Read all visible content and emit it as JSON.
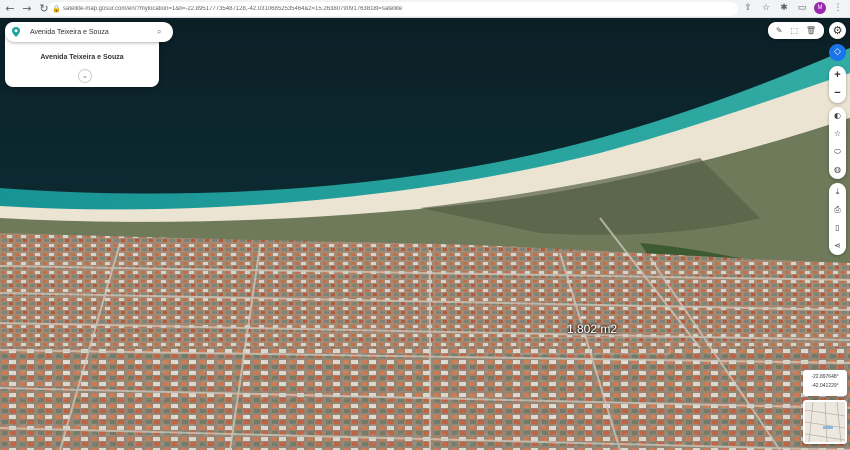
{
  "browser": {
    "url": "satellite-map.gosur.com/en/?mylocation=1&ll=-22.895177735487128,-42.03106852535464&z=15.2638079091763818t=satellite",
    "icons": [
      "back-icon",
      "forward-icon",
      "reload-icon",
      "lock-icon",
      "share-icon",
      "star-icon",
      "extensions-icon"
    ],
    "profile_initial": "M"
  },
  "search": {
    "value": "Avenida Teixeira e Souza",
    "place_title": "Avenida Teixeira e Souza"
  },
  "map": {
    "area_label": "1.802 m2",
    "coordinates": {
      "lat": "-22.897648°",
      "lng": "-42.041229°"
    }
  },
  "controls": {
    "zoom_in": "+",
    "zoom_out": "−",
    "tools": [
      "pencil-icon",
      "polygon-icon",
      "trash-icon"
    ],
    "right_tools": [
      "compass-icon",
      "star-icon",
      "layer-icon",
      "globe-icon",
      "download-icon",
      "print-icon",
      "mobile-icon",
      "share-icon"
    ]
  },
  "colors": {
    "accent": "#1a73e8",
    "ocean_deep": "#0a2a33",
    "ocean_shallow": "#2ab0a8",
    "beach": "#efe8d8"
  }
}
